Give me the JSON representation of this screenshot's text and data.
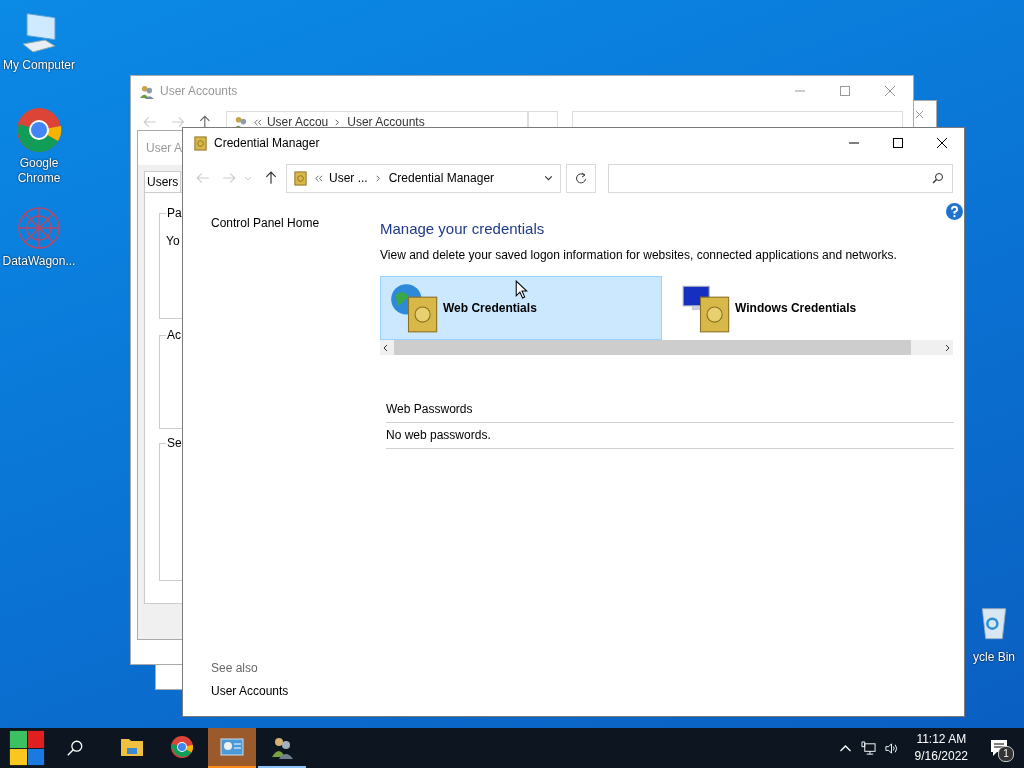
{
  "desktop": {
    "icons": [
      {
        "label": "My Computer",
        "kind": "computer"
      },
      {
        "label": "Google Chrome",
        "kind": "chrome"
      },
      {
        "label": "DataWagon...",
        "kind": "datawagon"
      },
      {
        "label": "ycle Bin",
        "kind": "recycle-bin"
      }
    ]
  },
  "background_windows": {
    "user_accounts": {
      "title": "User Accounts",
      "breadcrumb": [
        "User Accou",
        "User Accounts"
      ]
    },
    "user_accounts_dialog": {
      "title": "User A",
      "tab": "Users",
      "group_labels": [
        "Pa",
        "Ac",
        "Se"
      ],
      "group_text": "Yo"
    }
  },
  "window": {
    "title": "Credential Manager",
    "address": [
      "User ...",
      "Credential Manager"
    ],
    "sidebar": {
      "home_link": "Control Panel Home",
      "see_also_heading": "See also",
      "see_also_links": [
        "User Accounts"
      ]
    },
    "heading": "Manage your credentials",
    "description": "View and delete your saved logon information for websites, connected applications and networks.",
    "tiles": [
      {
        "label": "Web Credentials",
        "kind": "web",
        "selected": true
      },
      {
        "label": "Windows Credentials",
        "kind": "windows",
        "selected": false
      }
    ],
    "section": {
      "heading": "Web Passwords",
      "empty_text": "No web passwords."
    }
  },
  "taskbar": {
    "apps": [
      {
        "kind": "explorer",
        "selected": false,
        "running": false
      },
      {
        "kind": "chrome",
        "selected": false,
        "running": false
      },
      {
        "kind": "control-panel",
        "selected": true,
        "running": true
      },
      {
        "kind": "users",
        "selected": false,
        "running": true
      }
    ],
    "time": "11:12 AM",
    "date": "9/16/2022",
    "notification_count": "1"
  }
}
